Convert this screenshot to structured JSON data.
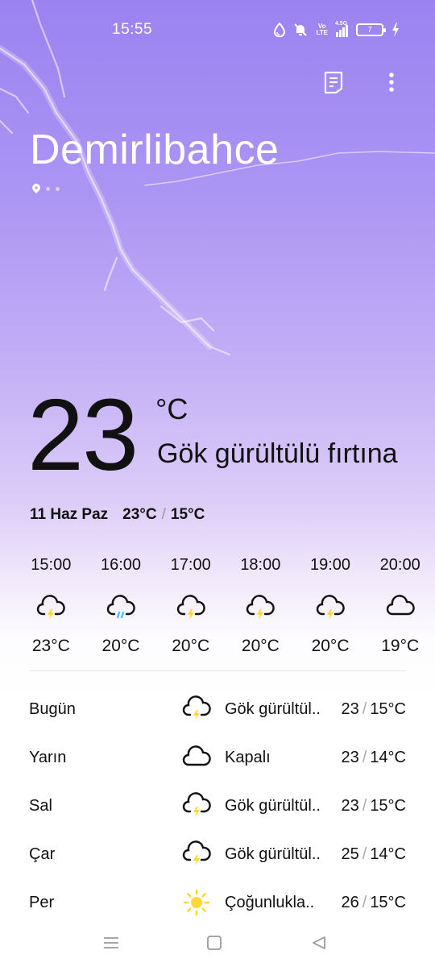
{
  "status_bar": {
    "time": "15:55",
    "icons": [
      "drop-icon",
      "bell-muted-icon",
      "volte-icon",
      "signal-icon",
      "battery-icon",
      "charging-icon"
    ],
    "volte_line1": "Vo",
    "volte_line2": "LTE",
    "network": "4.5G",
    "battery": "7"
  },
  "header": {
    "city": "Demirlibahce",
    "actions": [
      "document-icon",
      "more-vertical-icon"
    ]
  },
  "current": {
    "temperature": "23",
    "unit": "°C",
    "condition": "Gök gürültülü fırtına",
    "date": "11 Haz Paz",
    "high": "23°C",
    "separator": "/",
    "low": "15°C"
  },
  "hourly": [
    {
      "time": "15:00",
      "icon": "thunder-cloud-icon",
      "temp": "23°C"
    },
    {
      "time": "16:00",
      "icon": "rain-cloud-icon",
      "temp": "20°C"
    },
    {
      "time": "17:00",
      "icon": "thunder-cloud-icon",
      "temp": "20°C"
    },
    {
      "time": "18:00",
      "icon": "thunder-cloud-icon",
      "temp": "20°C"
    },
    {
      "time": "19:00",
      "icon": "thunder-cloud-icon",
      "temp": "20°C"
    },
    {
      "time": "20:00",
      "icon": "cloud-icon",
      "temp": "19°C"
    }
  ],
  "daily": [
    {
      "day": "Bugün",
      "icon": "thunder-cloud-icon",
      "condition": "Gök gürültül..",
      "high": "23",
      "sep": "/",
      "low": "15°C"
    },
    {
      "day": "Yarın",
      "icon": "cloud-icon",
      "condition": "Kapalı",
      "high": "23",
      "sep": "/",
      "low": "14°C"
    },
    {
      "day": "Sal",
      "icon": "thunder-cloud-icon",
      "condition": "Gök gürültül..",
      "high": "23",
      "sep": "/",
      "low": "15°C"
    },
    {
      "day": "Çar",
      "icon": "thunder-cloud-icon",
      "condition": "Gök gürültül..",
      "high": "25",
      "sep": "/",
      "low": "14°C"
    },
    {
      "day": "Per",
      "icon": "sun-icon",
      "condition": "Çoğunlukla..",
      "high": "26",
      "sep": "/",
      "low": "15°C"
    }
  ],
  "nav_bar": [
    "menu-icon",
    "home-icon",
    "back-icon"
  ],
  "colors": {
    "accent_bolt": "#fdd835",
    "rain": "#4fc3f7",
    "sky_top": "#9a83f0"
  }
}
